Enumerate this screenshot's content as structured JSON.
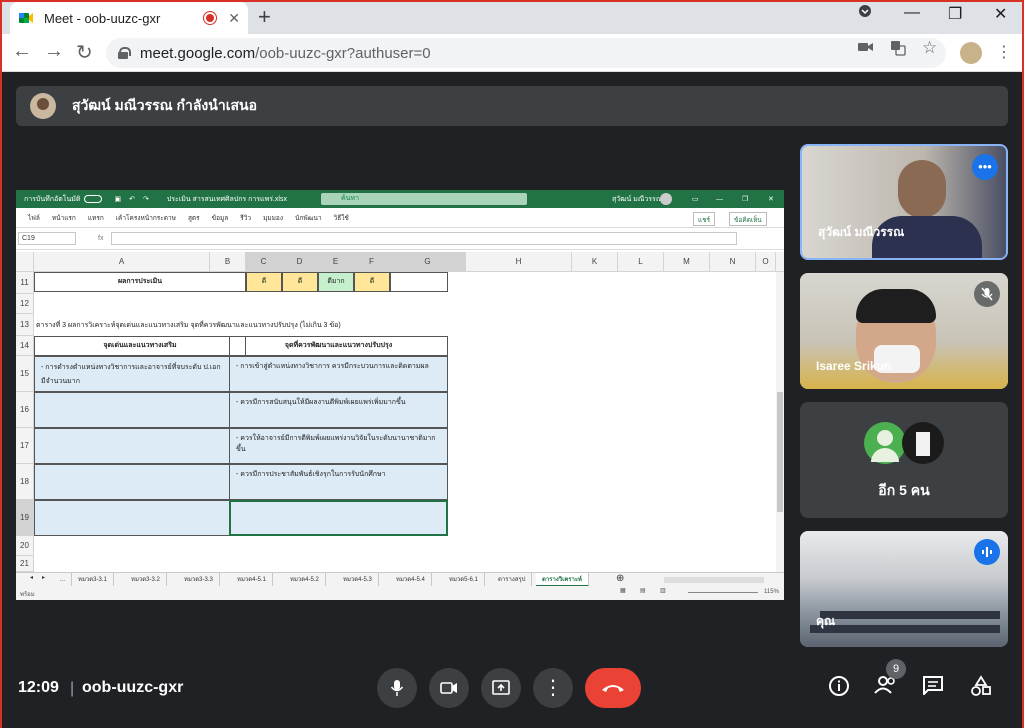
{
  "browser": {
    "tab_title": "Meet - oob-uuzc-gxr",
    "tab_close": "✕",
    "new_tab": "+",
    "url_host": "meet.google.com",
    "url_path": "/oob-uuzc-gxr?authuser=0",
    "minimize": "—",
    "restore": "❐",
    "close": "✕"
  },
  "banner": {
    "text": "สุวัฒน์ มณีวรรณ กำลังนำเสนอ"
  },
  "excel": {
    "autosave_label": "การบันทึกอัตโนมัติ",
    "file_name": "ประเมิน สารสนเทศศิลปกร การแพร่.xlsx",
    "search_placeholder": "ค้นหา",
    "user_name": "สุวัฒน์ มณีวรรณ",
    "menu": [
      "ไฟล์",
      "หน้าแรก",
      "แทรก",
      "เค้าโครงหน้ากระดาษ",
      "สูตร",
      "ข้อมูล",
      "รีวิว",
      "มุมมอง",
      "นักพัฒนา",
      "วิธีใช้"
    ],
    "share_label": "แชร์",
    "comment_label": "ข้อคิดเห็น",
    "name_box": "C19",
    "fx": "fx",
    "columns": [
      "A",
      "B",
      "C",
      "D",
      "E",
      "F",
      "G",
      "H",
      "K",
      "L",
      "M",
      "N",
      "O"
    ],
    "rows": [
      "11",
      "12",
      "13",
      "14",
      "15",
      "16",
      "17",
      "18",
      "19",
      "20",
      "21"
    ],
    "row11_label": "ผลการประเมิน",
    "row11_scores": [
      "ดี",
      "ดี",
      "ดีมาก",
      "ดี"
    ],
    "row13_text": "ตารางที่ 3 ผลการวิเคราะห์จุดเด่นและแนวทางเสริม จุดที่ควรพัฒนาและแนวทางปรับปรุง (ไม่เกิน 3 ข้อ)",
    "header_left": "จุดเด่นและแนวทางเสริม",
    "header_right": "จุดที่ควรพัฒนาและแนวทางปรับปรุง",
    "left_items": [
      "- การดำรงตำแหน่งทางวิชาการและอาจารย์ที่จบระดับ ป.เอก มีจำนวนมาก"
    ],
    "right_items": [
      "- การเข้าสู่ตำแหน่งทางวิชาการ ควรมีกระบวนการและติดตามผล",
      "- ควรมีการสนับสนุนให้มีผลงานตีพิมพ์เผยแพร่เพิ่มมากขึ้น",
      "- ควรให้อาจารย์มีการตีพิมพ์เผยแพร่งานวิจัยในระดับนานาชาติมากขึ้น",
      "- ควรมีการประชาสัมพันธ์เชิงรุกในการรับนักศึกษา"
    ],
    "sheets": [
      "...",
      "หมวด3-3.1",
      "หมวด3-3.2",
      "หมวด3-3.3",
      "หมวด4-5.1",
      "หมวด4-5.2",
      "หมวด4-5.3",
      "หมวด4-5.4",
      "หมวด5-6.1",
      "ตารางสรุป",
      "ตารางวิเคราะห์"
    ],
    "status_left": "พร้อม",
    "zoom": "115%"
  },
  "participants": [
    {
      "name": "สุวัฒน์ มณีวรรณ",
      "button": "•••"
    },
    {
      "name": "Isaree Srikun"
    },
    {
      "name": "อีก 5 คน"
    },
    {
      "name": "คุณ"
    }
  ],
  "bottom": {
    "time": "12:09",
    "separator": "|",
    "meeting_code": "oob-uuzc-gxr",
    "people_count": "9"
  },
  "colors": {
    "meet_bg": "#202124",
    "excel_green": "#217346",
    "hangup_red": "#ea4335",
    "active_blue": "#8ab4f8"
  }
}
